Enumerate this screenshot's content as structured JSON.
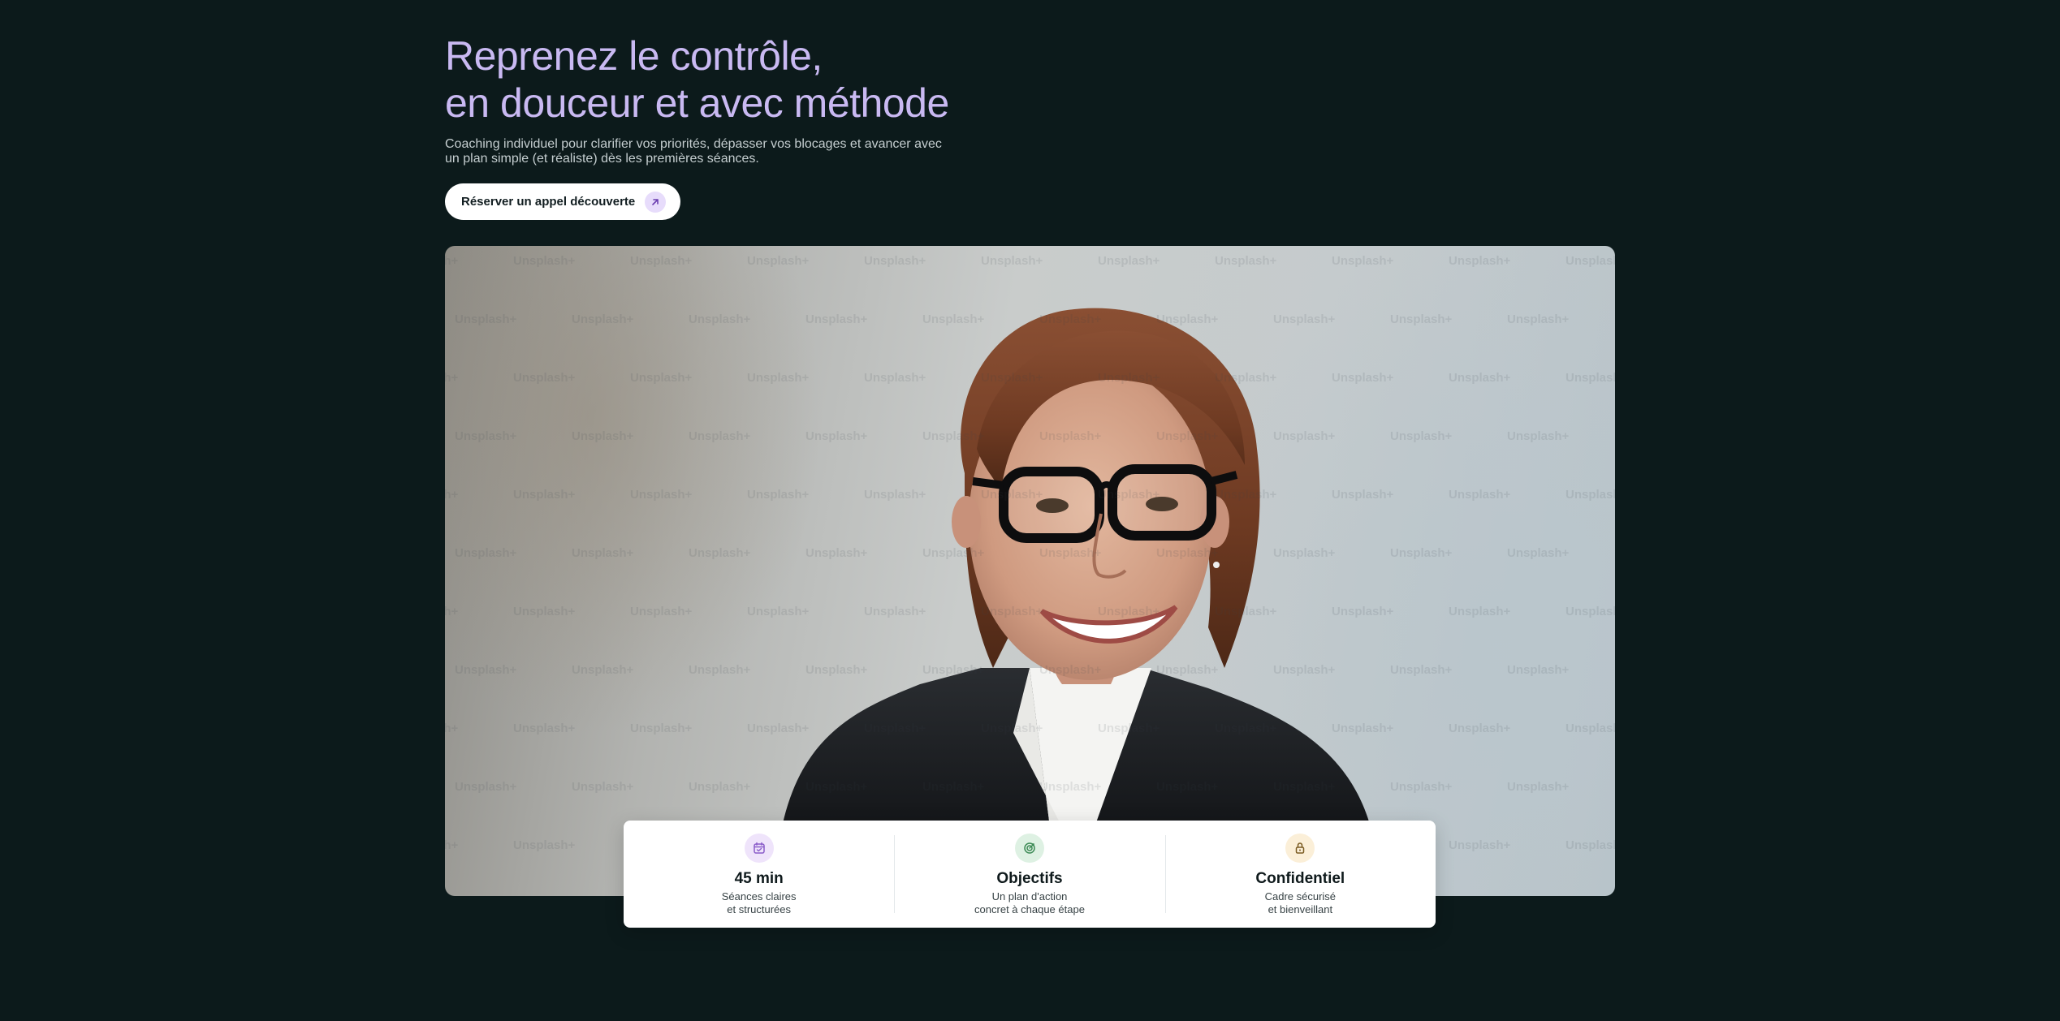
{
  "hero": {
    "title_line1": "Reprenez le contrôle,",
    "title_line2": "en douceur et avec méthode",
    "subtitle_line1": "Coaching individuel pour clarifier vos priorités, dépasser vos blocages et avancer avec",
    "subtitle_line2": "un plan simple (et réaliste) dès les premières séances.",
    "cta_label": "Réserver un appel découverte",
    "cta_icon": "arrow-up-right-icon"
  },
  "photo": {
    "alt": "Portrait d'une femme souriante avec des lunettes",
    "watermark": "Unsplash+"
  },
  "stats": [
    {
      "icon": "calendar-icon",
      "icon_bg": "#efe4fb",
      "icon_color": "#8a5cc9",
      "value": "45 min",
      "desc_line1": "Séances claires",
      "desc_line2": "et structurées"
    },
    {
      "icon": "target-icon",
      "icon_bg": "#def1e3",
      "icon_color": "#3c8a55",
      "value": "Objectifs",
      "desc_line1": "Un plan d'action",
      "desc_line2": "concret à chaque étape"
    },
    {
      "icon": "lock-icon",
      "icon_bg": "#fbefd8",
      "icon_color": "#7a5b22",
      "value": "Confidentiel",
      "desc_line1": "Cadre sécurisé",
      "desc_line2": "et bienveillant"
    }
  ],
  "colors": {
    "background": "#0c1a1b",
    "headline": "#c9b9f2",
    "cta_bg": "#ffffff",
    "cta_icon_bg": "#e7dcfb"
  }
}
